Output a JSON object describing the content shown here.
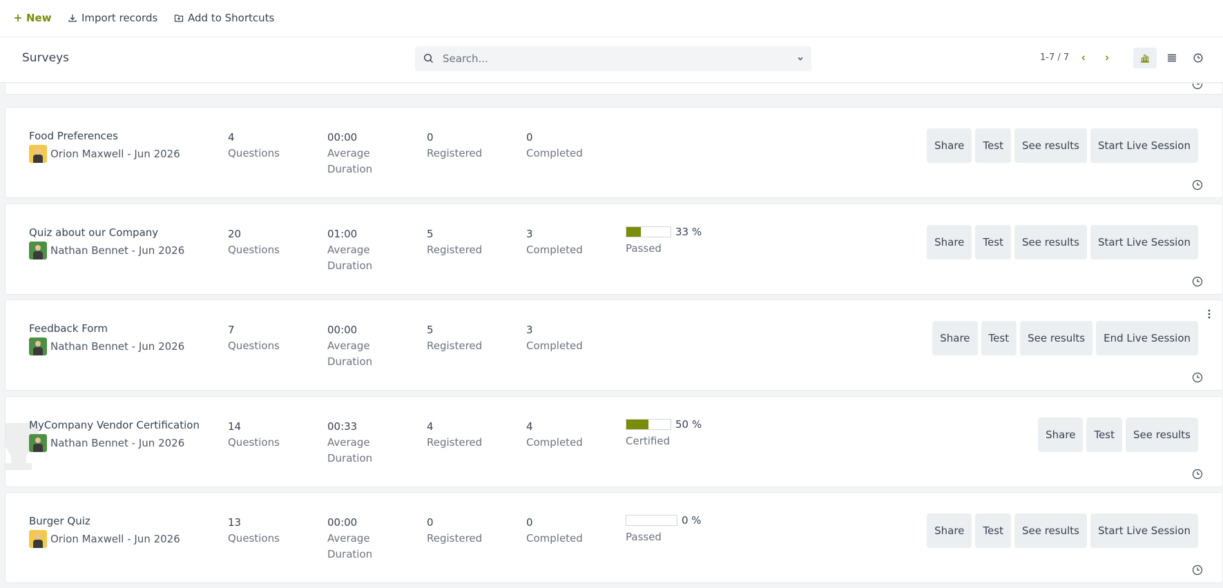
{
  "toolbar": {
    "new_label": "New",
    "import_label": "Import records",
    "shortcuts_label": "Add to Shortcuts"
  },
  "header": {
    "title": "Surveys",
    "search_placeholder": "Search...",
    "pager": "1-7 / 7"
  },
  "colors": {
    "accent": "#7a8c0a",
    "button_bg": "#eceff1"
  },
  "surveys": [
    {
      "name": "Food Preferences",
      "owner": "Orion Maxwell - Jun 2026",
      "questions": "4",
      "questions_label": "Questions",
      "duration": "00:00",
      "duration_label_1": "Average",
      "duration_label_2": "Duration",
      "registered": "0",
      "registered_label": "Registered",
      "completed": "0",
      "completed_label": "Completed",
      "actions": [
        "Share",
        "Test",
        "See results",
        "Start Live Session"
      ]
    },
    {
      "name": "Quiz about our Company",
      "owner": "Nathan Bennet - Jun 2026",
      "questions": "20",
      "questions_label": "Questions",
      "duration": "01:00",
      "duration_label_1": "Average",
      "duration_label_2": "Duration",
      "registered": "5",
      "registered_label": "Registered",
      "completed": "3",
      "completed_label": "Completed",
      "progress_pct": 33,
      "progress_text": "33 %",
      "progress_label": "Passed",
      "actions": [
        "Share",
        "Test",
        "See results",
        "Start Live Session"
      ]
    },
    {
      "name": "Feedback Form",
      "owner": "Nathan Bennet - Jun 2026",
      "questions": "7",
      "questions_label": "Questions",
      "duration": "00:00",
      "duration_label_1": "Average",
      "duration_label_2": "Duration",
      "registered": "5",
      "registered_label": "Registered",
      "completed": "3",
      "completed_label": "Completed",
      "actions": [
        "Share",
        "Test",
        "See results",
        "End Live Session"
      ]
    },
    {
      "name": "MyCompany Vendor Certification",
      "owner": "Nathan Bennet - Jun 2026",
      "questions": "14",
      "questions_label": "Questions",
      "duration": "00:33",
      "duration_label_1": "Average",
      "duration_label_2": "Duration",
      "registered": "4",
      "registered_label": "Registered",
      "completed": "4",
      "completed_label": "Completed",
      "progress_pct": 50,
      "progress_text": "50 %",
      "progress_label": "Certified",
      "actions": [
        "Share",
        "Test",
        "See results"
      ]
    },
    {
      "name": "Burger Quiz",
      "owner": "Orion Maxwell - Jun 2026",
      "questions": "13",
      "questions_label": "Questions",
      "duration": "00:00",
      "duration_label_1": "Average",
      "duration_label_2": "Duration",
      "registered": "0",
      "registered_label": "Registered",
      "completed": "0",
      "completed_label": "Completed",
      "progress_pct": 0,
      "progress_text": "0 %",
      "progress_label": "Passed",
      "actions": [
        "Share",
        "Test",
        "See results",
        "Start Live Session"
      ]
    }
  ]
}
